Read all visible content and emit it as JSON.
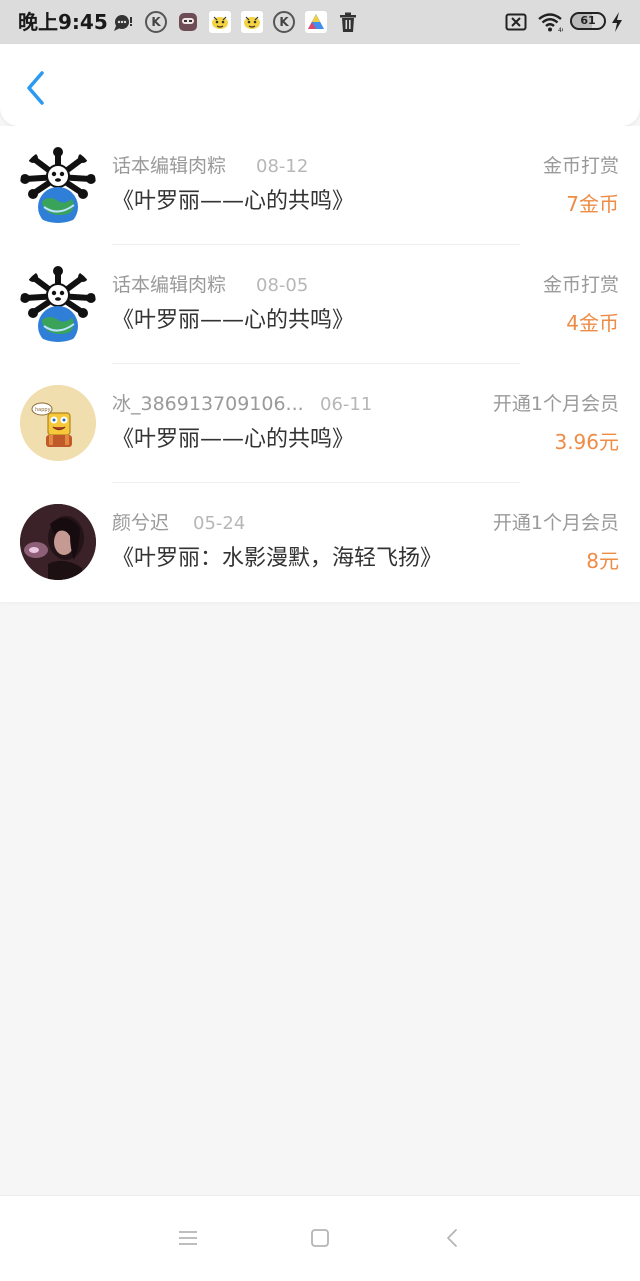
{
  "status_bar": {
    "time": "晚上9:45",
    "battery_level": "61",
    "battery_fraction": 0.61,
    "k_label": "K",
    "icons": [
      "chat-bubble-icon",
      "k-app-icon",
      "mask-app-icon",
      "cartoon-app-icon",
      "cartoon-app-icon",
      "k-app-icon",
      "triangle-app-icon",
      "trash-icon",
      "sim-off-icon",
      "wifi-icon",
      "battery-icon",
      "charging-icon"
    ]
  },
  "header": {
    "back_icon": "chevron-left-icon",
    "accent": "#2b9af3"
  },
  "records": [
    {
      "user": "话本编辑肉粽",
      "date": "08-12",
      "title": "《叶罗丽——心的共鸣》",
      "type": "金币打赏",
      "amount": "7金币",
      "avatar": "panda-earth-avatar"
    },
    {
      "user": "话本编辑肉粽",
      "date": "08-05",
      "title": "《叶罗丽——心的共鸣》",
      "type": "金币打赏",
      "amount": "4金币",
      "avatar": "panda-earth-avatar"
    },
    {
      "user": "冰_386913709106...",
      "date": "06-11",
      "title": "《叶罗丽——心的共鸣》",
      "type": "开通1个月会员",
      "amount": "3.96元",
      "avatar": "sponge-avatar"
    },
    {
      "user": "颜兮迟",
      "date": "05-24",
      "title": "《叶罗丽：水影漫默，海轻飞扬》",
      "type": "开通1个月会员",
      "amount": "8元",
      "avatar": "portrait-avatar"
    }
  ],
  "colors": {
    "amount": "#ee8b45",
    "secondary_text": "#9a9a9a",
    "primary_text": "#333333",
    "page_background": "#f7f6f7"
  },
  "nav_bar": {
    "icons": [
      "menu-icon",
      "home-square-icon",
      "back-arrow-icon"
    ]
  }
}
